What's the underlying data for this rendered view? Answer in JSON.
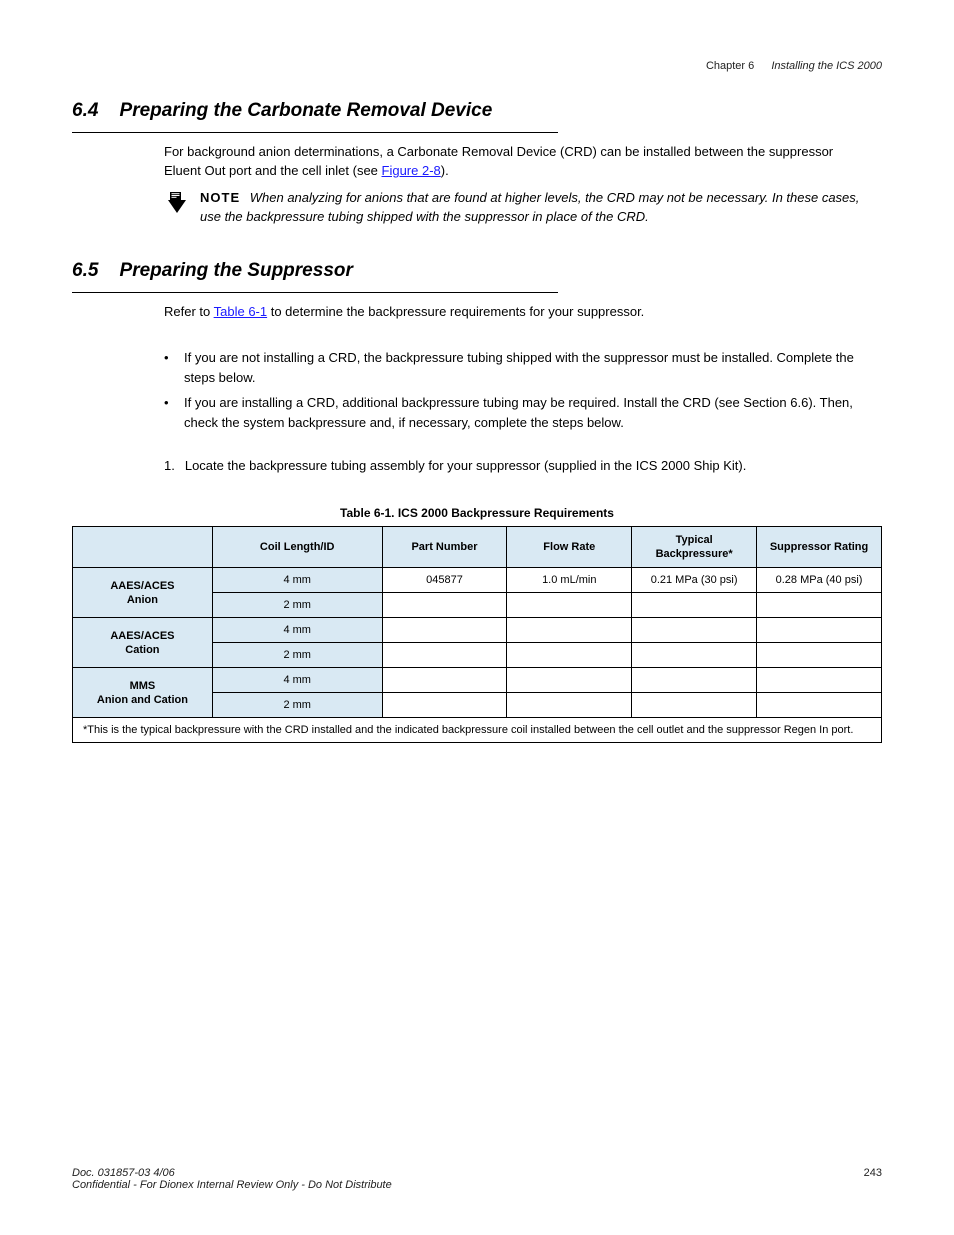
{
  "header": {
    "chapter_num": "Chapter 6",
    "chapter_title": "Installing the ICS 2000"
  },
  "section1": {
    "number": "6.4",
    "title": "Preparing the Carbonate Removal Device",
    "para": "For background anion determinations, a Carbonate Removal Device (CRD) can be installed between the suppressor Eluent Out port and the cell inlet (see ",
    "link_text": "Figure 2-8",
    "para_after": ").",
    "note_prefix": "NOTE",
    "note_text": "When analyzing for anions that are found at higher levels, the CRD may not be necessary. In these cases, use the backpressure tubing shipped with the suppressor in place of the CRD."
  },
  "section2": {
    "number": "6.5",
    "title": "Preparing the Suppressor",
    "intro_text": "Refer to ",
    "intro_link": "Table 6-1",
    "intro_after": " to determine the backpressure requirements for your suppressor.",
    "bullets": [
      "If you are not installing a CRD, the backpressure tubing shipped with the suppressor must be installed. Complete the steps below.",
      "If you are installing a CRD, additional backpressure tubing may be required. Install the CRD (see Section 6.6). Then, check the system backpressure and, if necessary, complete the steps below."
    ],
    "step_num": "1.",
    "step_text": "Locate the backpressure tubing assembly for your suppressor (supplied in the ICS 2000 Ship Kit)."
  },
  "table": {
    "label": "Table 6-1. ICS 2000 Backpressure Requirements",
    "headers": [
      "",
      "Coil Length/ID",
      "Part Number",
      "Flow Rate",
      "Typical Backpressure*",
      "Suppressor Rating"
    ],
    "groups": [
      {
        "label_line1": "AAES/ACES",
        "label_line2": "Anion",
        "rows": [
          {
            "size": "4 mm",
            "pn": "045877",
            "flow": "1.0 mL/min",
            "bp": "0.21 MPa (30 psi)",
            "rating": "0.28 MPa (40 psi)"
          },
          {
            "size": "2 mm",
            "pn": "",
            "flow": "",
            "bp": "",
            "rating": ""
          }
        ]
      },
      {
        "label_line1": "AAES/ACES",
        "label_line2": "Cation",
        "rows": [
          {
            "size": "4 mm",
            "pn": "",
            "flow": "",
            "bp": "",
            "rating": ""
          },
          {
            "size": "2 mm",
            "pn": "",
            "flow": "",
            "bp": "",
            "rating": ""
          }
        ]
      },
      {
        "label_line1": "MMS",
        "label_line2": "Anion and Cation",
        "rows": [
          {
            "size": "4 mm",
            "pn": "",
            "flow": "",
            "bp": "",
            "rating": ""
          },
          {
            "size": "2 mm",
            "pn": "",
            "flow": "",
            "bp": "",
            "rating": ""
          }
        ]
      }
    ],
    "footnote": "*This is the typical backpressure with the CRD installed and the indicated backpressure coil installed between the cell outlet and the suppressor Regen In port."
  },
  "footer": {
    "doc_num": "Doc. 031857-03 4/06",
    "confidential": "Confidential - For Dionex Internal Review Only - Do Not Distribute",
    "page": "243"
  }
}
